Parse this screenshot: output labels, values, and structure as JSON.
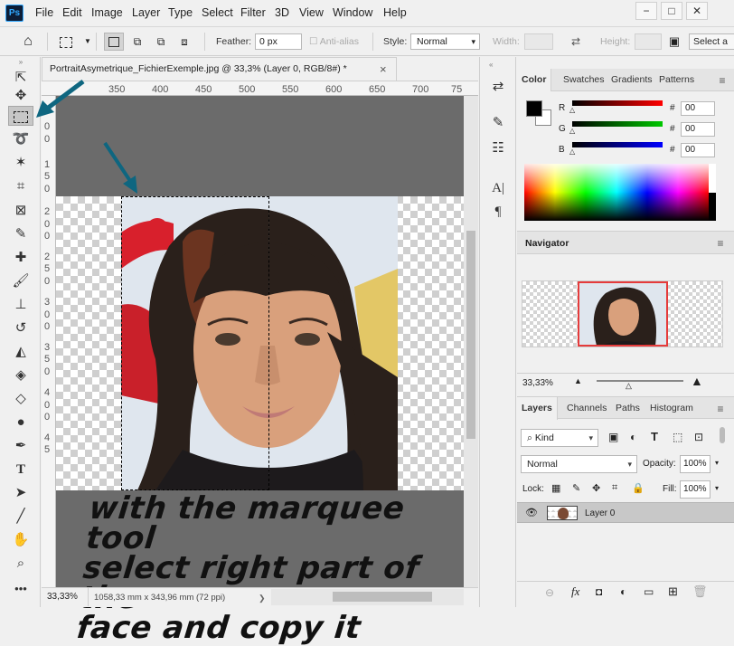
{
  "app_logo": "Ps",
  "menu": [
    "File",
    "Edit",
    "Image",
    "Layer",
    "Type",
    "Select",
    "Filter",
    "3D",
    "View",
    "Window",
    "Help"
  ],
  "window_buttons": [
    "−",
    "□",
    "✕"
  ],
  "options": {
    "feather_label": "Feather:",
    "feather_value": "0 px",
    "antialias_label": "Anti-alias",
    "style_label": "Style:",
    "style_value": "Normal",
    "width_label": "Width:",
    "height_label": "Height:",
    "select_and_mask": "Select a"
  },
  "document": {
    "tab_title": "PortraitAsymetrique_FichierExemple.jpg @ 33,3% (Layer 0, RGB/8#) *",
    "close": "×",
    "ruler_h": [
      "350",
      "400",
      "450",
      "500",
      "550",
      "600",
      "650",
      "700",
      "75"
    ],
    "ruler_v": [
      "0",
      "0",
      "1",
      "5",
      "0",
      "2",
      "0",
      "0",
      "2",
      "5",
      "0",
      "3",
      "0",
      "0",
      "3",
      "5",
      "0",
      "4",
      "0",
      "0",
      "4",
      "5"
    ],
    "caption_lines": [
      "with the marquee tool",
      "select right part of the",
      "face and copy it"
    ]
  },
  "status": {
    "zoom": "33,33%",
    "info": "1058,33 mm x 343,96 mm (72 ppi)"
  },
  "color_panel": {
    "tabs": [
      "Color",
      "Swatches",
      "Gradients",
      "Patterns"
    ],
    "channels": [
      {
        "label": "R",
        "value": "00",
        "color": "#ff0000"
      },
      {
        "label": "G",
        "value": "00",
        "color": "#00c800"
      },
      {
        "label": "B",
        "value": "00",
        "color": "#0000ff"
      }
    ],
    "hash": "#"
  },
  "navigator": {
    "title": "Navigator",
    "zoom": "33,33%"
  },
  "layers_panel": {
    "tabs": [
      "Layers",
      "Channels",
      "Paths",
      "Histogram"
    ],
    "filter_kind": "Kind",
    "blend_mode": "Normal",
    "opacity_label": "Opacity:",
    "opacity_value": "100%",
    "lock_label": "Lock:",
    "fill_label": "Fill:",
    "fill_value": "100%",
    "layers": [
      {
        "name": "Layer 0"
      }
    ]
  },
  "annotation_color": "#0e6680"
}
